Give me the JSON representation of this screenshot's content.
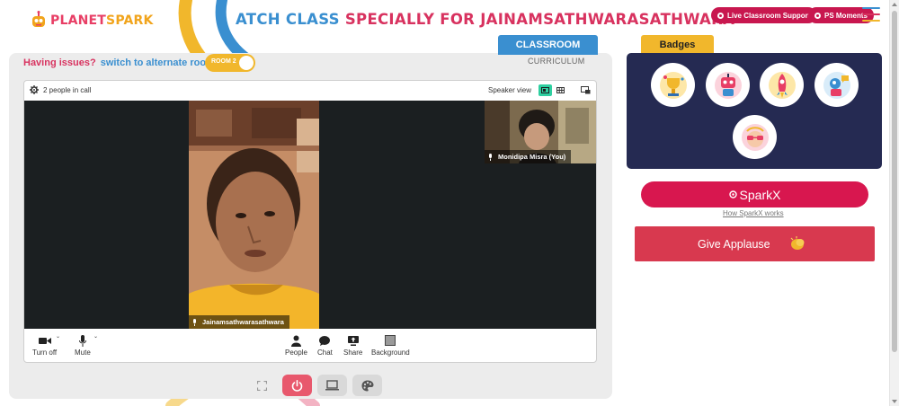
{
  "header": {
    "logo": {
      "part1": "PLANET",
      "part2": "SPARK"
    },
    "headline": {
      "part1": "ATCH CLASS",
      "part2": " SPECIALLY FOR JAINAMSATHWARASATHWARA"
    },
    "live_support_label": "Live Classroom Support",
    "ps_moments_label": "PS Moments"
  },
  "tabs": {
    "classroom_label": "CLASSROOM",
    "curriculum_label": "CURRICULUM"
  },
  "issues": {
    "label": "Having issues?",
    "link": "switch to alternate room",
    "room_toggle_label": "ROOM 2"
  },
  "call": {
    "people_count": "2 people in call",
    "speaker_view_label": "Speaker view",
    "main_participant": "Jainamsathwarasathwara",
    "self_participant": "Monidipa Misra (You)",
    "controls": [
      {
        "label": "Turn off",
        "icon": "camera-icon"
      },
      {
        "label": "Mute",
        "icon": "microphone-icon"
      },
      {
        "label": "People",
        "icon": "person-icon"
      },
      {
        "label": "Chat",
        "icon": "chat-icon"
      },
      {
        "label": "Share",
        "icon": "screen-share-icon"
      },
      {
        "label": "Background",
        "icon": "background-icon"
      }
    ]
  },
  "bottom_tools": [
    "fullscreen-icon",
    "power-icon",
    "laptop-icon",
    "palette-icon"
  ],
  "badges": {
    "tab_label": "Badges",
    "items": [
      "trophy-badge-icon",
      "robot-badge-icon",
      "rocket-badge-icon",
      "speaker-badge-icon",
      "glasses-badge-icon"
    ]
  },
  "sparkx": {
    "button_label": "SparkX",
    "link_label": "How SparkX works"
  },
  "applause": {
    "button_label": "Give Applause"
  },
  "colors": {
    "brand_pink": "#d8174f",
    "brand_blue": "#3a8fd0",
    "brand_yellow": "#f1b72c",
    "badge_panel": "#252a52",
    "applause": "#d8394f"
  }
}
